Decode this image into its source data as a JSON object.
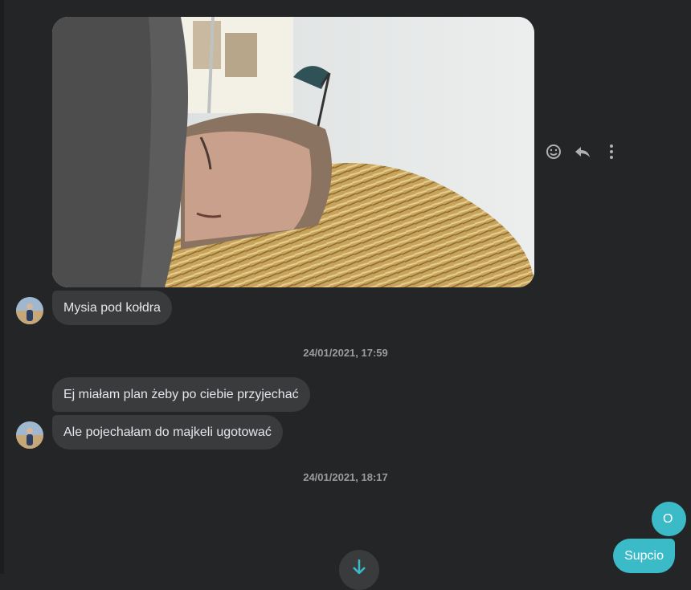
{
  "messages": {
    "incoming": [
      {
        "text": "Mysia pod kołdra"
      },
      {
        "text": "Ej miałam plan żeby po ciebie przyjechać"
      },
      {
        "text": "Ale pojechałam do majkeli ugotować"
      }
    ],
    "outgoing": [
      {
        "text": "O"
      },
      {
        "text": "Supcio"
      }
    ],
    "timestamps": [
      "24/01/2021, 17:59",
      "24/01/2021, 18:17"
    ]
  },
  "icons": {
    "react": "smiley-icon",
    "reply": "reply-arrow-icon",
    "more": "vertical-dots-icon",
    "scroll": "arrow-down-icon"
  },
  "colors": {
    "background": "#242526",
    "incoming_bubble": "#3a3b3c",
    "outgoing_bubble": "#3bbac7",
    "text": "#e4e6eb",
    "muted": "#9b9c9e"
  }
}
